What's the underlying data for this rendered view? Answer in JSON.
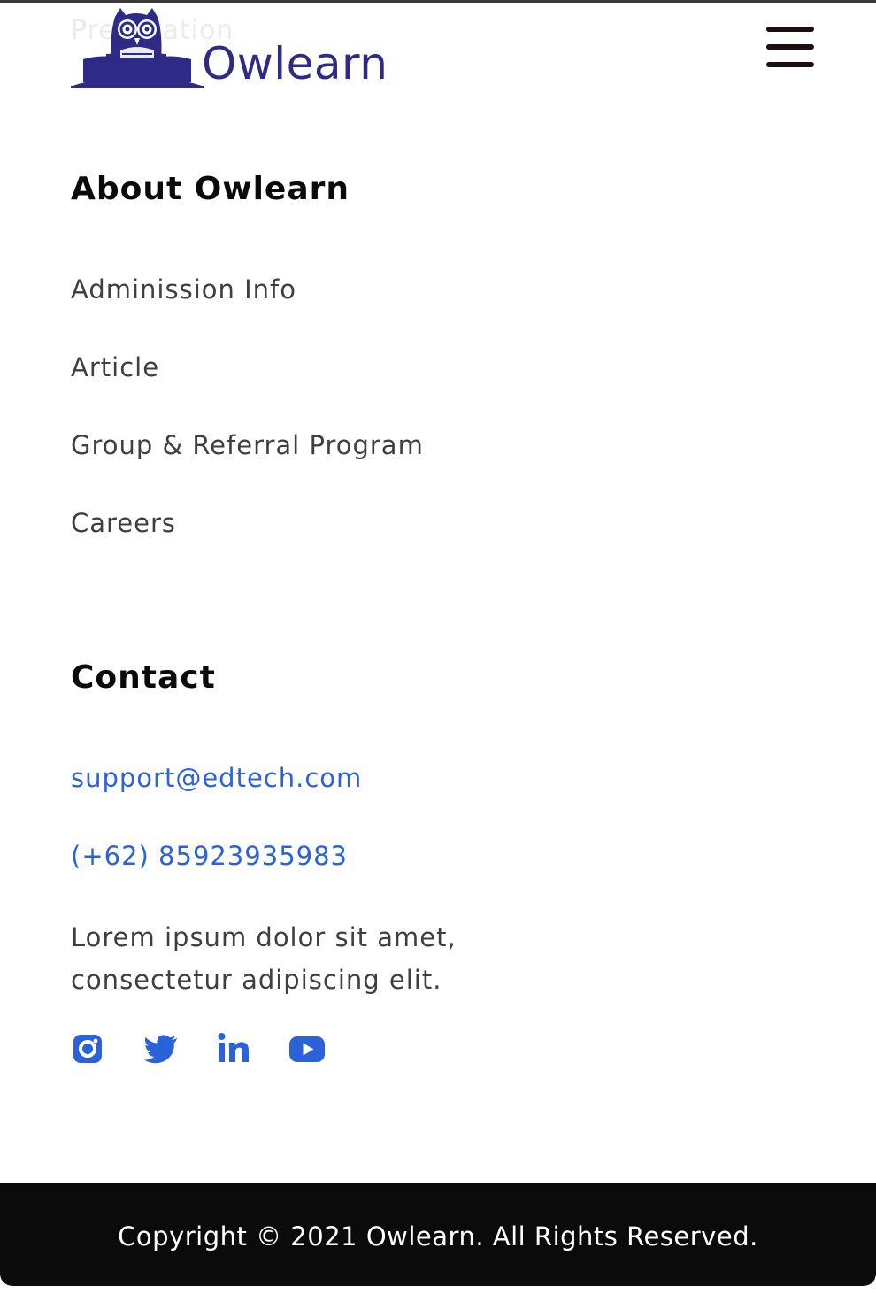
{
  "header": {
    "faded_text": "Preparation",
    "logo_text": "Owlearn",
    "brand_color": "#2e2b86",
    "menu_icon": "hamburger-menu-icon"
  },
  "about": {
    "heading": "About Owlearn",
    "links": [
      "Adminission Info",
      "Article",
      "Group & Referral Program",
      "Careers"
    ]
  },
  "contact": {
    "heading": "Contact",
    "email": "support@edtech.com",
    "phone": "(+62) 85923935983",
    "address_line1": "Lorem ipsum dolor sit amet,",
    "address_line2": "consectetur adipiscing elit.",
    "link_color": "#2c62d9",
    "social": [
      {
        "name": "instagram-icon"
      },
      {
        "name": "twitter-icon"
      },
      {
        "name": "linkedin-icon"
      },
      {
        "name": "youtube-icon"
      }
    ]
  },
  "footer": {
    "copyright": "Copyright © 2021 Owlearn. All Rights Reserved.",
    "background": "#0b0b0b"
  }
}
